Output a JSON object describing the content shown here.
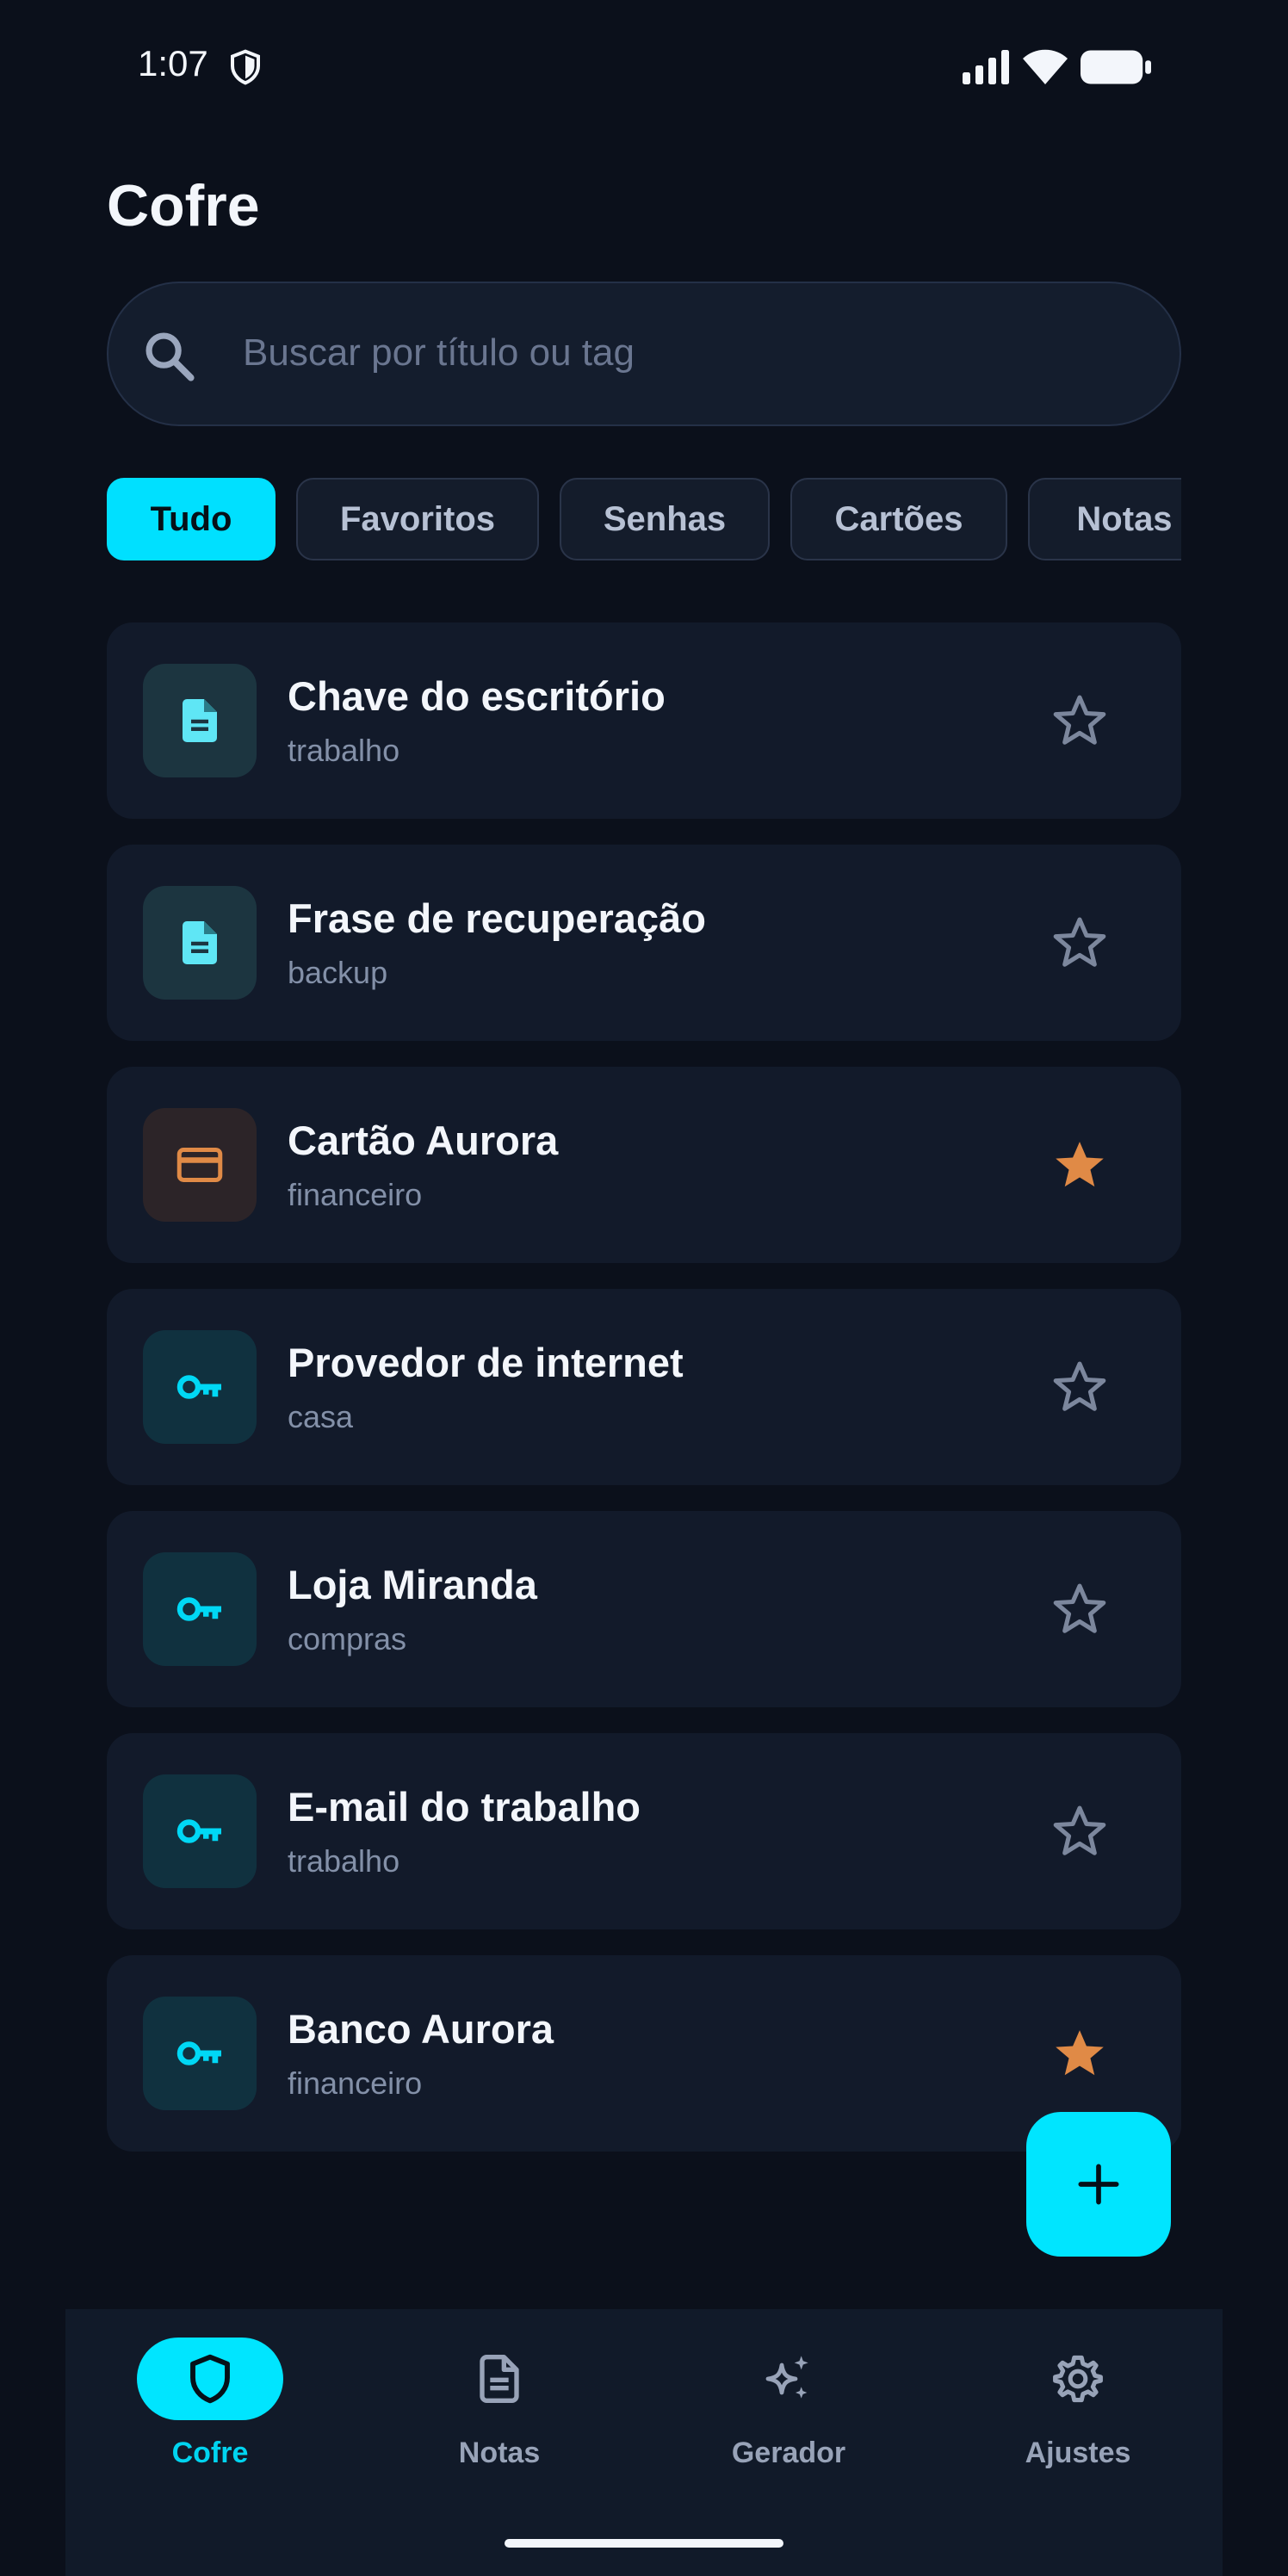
{
  "status_bar": {
    "time": "1:07"
  },
  "header": {
    "title": "Cofre"
  },
  "search": {
    "placeholder": "Buscar por título ou tag"
  },
  "filters": [
    {
      "label": "Tudo",
      "active": true
    },
    {
      "label": "Favoritos",
      "active": false
    },
    {
      "label": "Senhas",
      "active": false
    },
    {
      "label": "Cartões",
      "active": false
    },
    {
      "label": "Notas",
      "active": false
    }
  ],
  "items": [
    {
      "title": "Chave do escritório",
      "tag": "trabalho",
      "type": "note",
      "icon": "document-icon",
      "favorite": false
    },
    {
      "title": "Frase de recuperação",
      "tag": "backup",
      "type": "note",
      "icon": "document-icon",
      "favorite": false
    },
    {
      "title": "Cartão Aurora",
      "tag": "financeiro",
      "type": "card",
      "icon": "credit-card-icon",
      "favorite": true
    },
    {
      "title": "Provedor de internet",
      "tag": "casa",
      "type": "password",
      "icon": "key-icon",
      "favorite": false
    },
    {
      "title": "Loja Miranda",
      "tag": "compras",
      "type": "password",
      "icon": "key-icon",
      "favorite": false
    },
    {
      "title": "E-mail do trabalho",
      "tag": "trabalho",
      "type": "password",
      "icon": "key-icon",
      "favorite": false
    },
    {
      "title": "Banco Aurora",
      "tag": "financeiro",
      "type": "password",
      "icon": "key-icon",
      "favorite": true
    }
  ],
  "fab": {
    "icon": "plus-icon"
  },
  "nav": [
    {
      "label": "Cofre",
      "icon": "shield-icon",
      "active": true
    },
    {
      "label": "Notas",
      "icon": "document-icon",
      "active": false
    },
    {
      "label": "Gerador",
      "icon": "sparkles-icon",
      "active": false
    },
    {
      "label": "Ajustes",
      "icon": "gear-icon",
      "active": false
    }
  ],
  "colors": {
    "background": "#0b101b",
    "accent": "#00e5ff",
    "favorite_star": "#e08a46",
    "card_icon": "#e08a46",
    "note_icon": "#5fe6f5",
    "key_icon": "#00d8f5"
  }
}
